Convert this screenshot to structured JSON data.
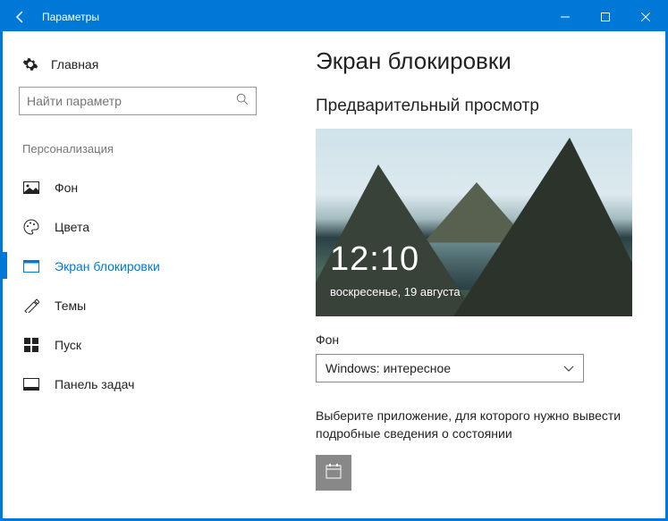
{
  "window": {
    "title": "Параметры"
  },
  "sidebar": {
    "home": "Главная",
    "search_placeholder": "Найти параметр",
    "section": "Персонализация",
    "items": [
      {
        "label": "Фон"
      },
      {
        "label": "Цвета"
      },
      {
        "label": "Экран блокировки"
      },
      {
        "label": "Темы"
      },
      {
        "label": "Пуск"
      },
      {
        "label": "Панель задач"
      }
    ]
  },
  "main": {
    "title": "Экран блокировки",
    "preview_heading": "Предварительный просмотр",
    "preview": {
      "time": "12:10",
      "date": "воскресенье, 19 августа"
    },
    "background_label": "Фон",
    "background_value": "Windows: интересное",
    "app_status_text": "Выберите приложение, для которого нужно вывести подробные сведения о состоянии"
  }
}
